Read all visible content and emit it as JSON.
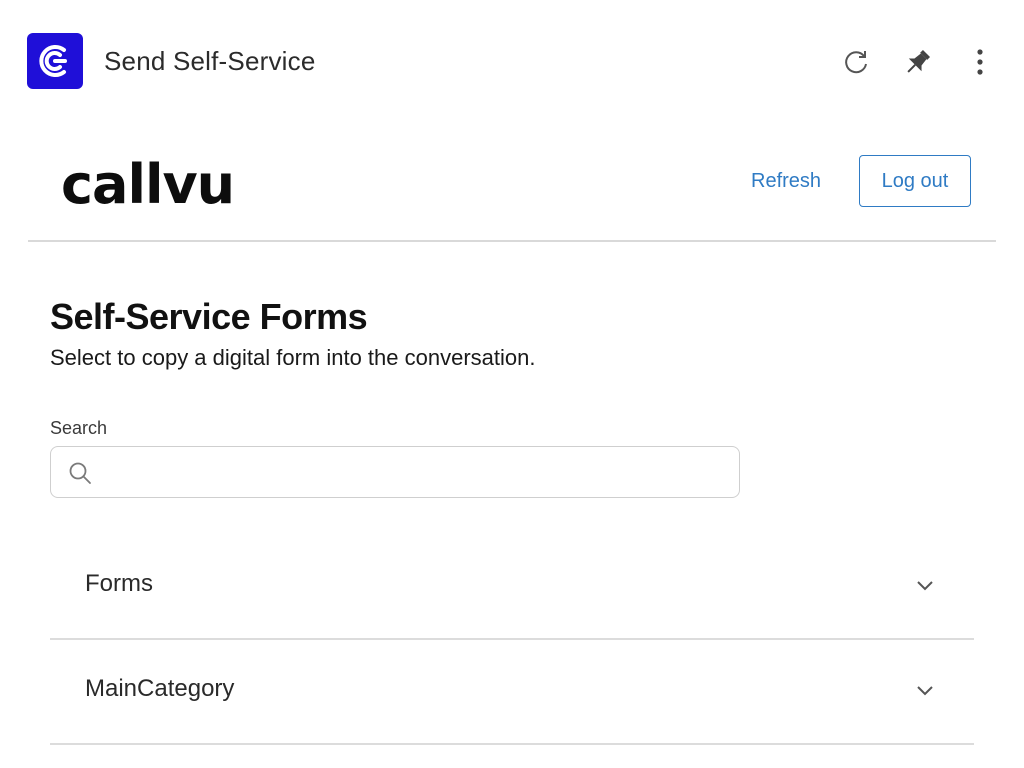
{
  "app": {
    "title": "Send Self-Service",
    "logo_color": "#1f0fd8"
  },
  "header": {
    "brand": "callvu",
    "refresh_label": "Refresh",
    "logout_label": "Log out",
    "link_color": "#2f7bc4"
  },
  "main": {
    "title": "Self-Service Forms",
    "subtitle": "Select to copy a digital form into the conversation.",
    "search": {
      "label": "Search",
      "value": "",
      "placeholder": ""
    },
    "categories": [
      {
        "label": "Forms",
        "icon": "chevron-down-icon"
      },
      {
        "label": "MainCategory",
        "icon": "chevron-down-icon"
      }
    ]
  },
  "icons": {
    "reload": "reload-icon",
    "pin": "pin-icon",
    "more": "more-vertical-icon",
    "search": "search-icon"
  }
}
